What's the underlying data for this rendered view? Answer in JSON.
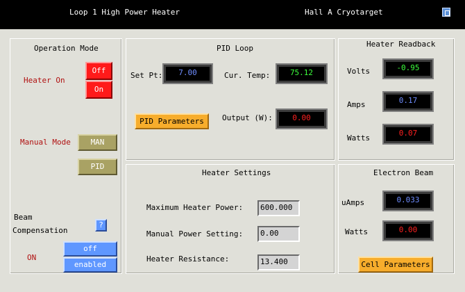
{
  "titlebar": {
    "title": "Loop 1 High Power Heater",
    "subtitle": "Hall A Cryotarget"
  },
  "operation_mode": {
    "heading": "Operation Mode",
    "heater_on_label": "Heater On",
    "off_label": "Off",
    "on_label": "On",
    "manual_mode_label": "Manual Mode",
    "man_label": "MAN",
    "pid_label": "PID",
    "beam_comp_label_1": "Beam",
    "beam_comp_label_2": "Compensation",
    "help_label": "?",
    "status_label": "ON",
    "off_button": "off",
    "enabled_button": "enabled"
  },
  "pid_loop": {
    "heading": "PID Loop",
    "setpt_label": "Set Pt:",
    "setpt_value": "7.00",
    "curtemp_label": "Cur. Temp:",
    "curtemp_value": "75.12",
    "pid_params_button": "PID Parameters",
    "output_label": "Output (W):",
    "output_value": "0.00"
  },
  "heater_readback": {
    "heading": "Heater Readback",
    "volts_label": "Volts",
    "volts_value": "-0.95",
    "amps_label": "Amps",
    "amps_value": "0.17",
    "watts_label": "Watts",
    "watts_value": "0.07"
  },
  "heater_settings": {
    "heading": "Heater Settings",
    "max_power_label": "Maximum Heater Power:",
    "max_power_value": "600.000",
    "manual_power_label": "Manual Power Setting:",
    "manual_power_value": "0.00",
    "resistance_label": "Heater Resistance:",
    "resistance_value": "13.400"
  },
  "electron_beam": {
    "heading": "Electron Beam",
    "uamps_label": "uAmps",
    "uamps_value": "0.033",
    "watts_label": "Watts",
    "watts_value": "0.00",
    "cell_params_button": "Cell Parameters"
  },
  "colors": {
    "green": "#3cff3c",
    "blue": "#6f8dff",
    "red": "#ff2020",
    "panel_bg": "#e0e0d9"
  }
}
